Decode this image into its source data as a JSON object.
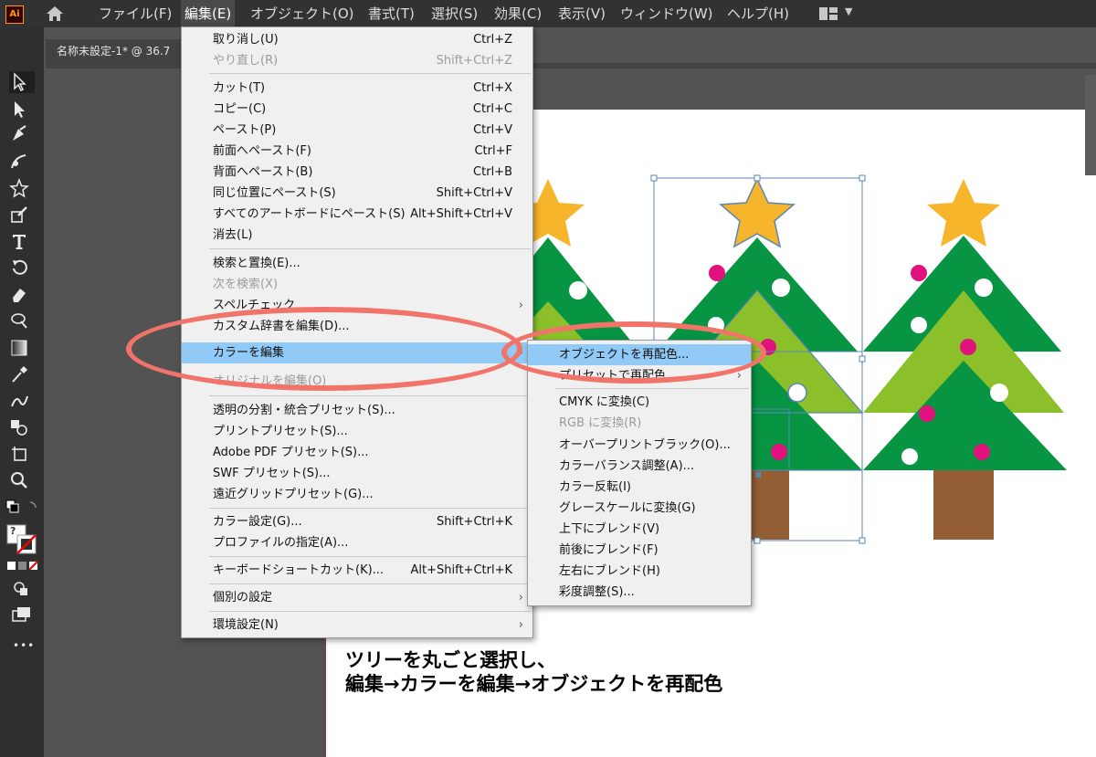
{
  "app": {
    "logo_text": "Ai"
  },
  "menubar": {
    "items": [
      "ファイル(F)",
      "編集(E)",
      "オブジェクト(O)",
      "書式(T)",
      "選択(S)",
      "効果(C)",
      "表示(V)",
      "ウィンドウ(W)",
      "ヘルプ(H)"
    ]
  },
  "document": {
    "tab_title": "名称未設定-1* @ 36.7"
  },
  "edit_menu": {
    "items": [
      {
        "label": "取り消し(U)",
        "shortcut": "Ctrl+Z"
      },
      {
        "label": "やり直し(R)",
        "shortcut": "Shift+Ctrl+Z",
        "disabled": true
      },
      {
        "label": "カット(T)",
        "shortcut": "Ctrl+X"
      },
      {
        "label": "コピー(C)",
        "shortcut": "Ctrl+C"
      },
      {
        "label": "ペースト(P)",
        "shortcut": "Ctrl+V"
      },
      {
        "label": "前面へペースト(F)",
        "shortcut": "Ctrl+F"
      },
      {
        "label": "背面へペースト(B)",
        "shortcut": "Ctrl+B"
      },
      {
        "label": "同じ位置にペースト(S)",
        "shortcut": "Shift+Ctrl+V"
      },
      {
        "label": "すべてのアートボードにペースト(S)",
        "shortcut": "Alt+Shift+Ctrl+V"
      },
      {
        "label": "消去(L)",
        "shortcut": ""
      },
      {
        "label": "検索と置換(E)...",
        "shortcut": ""
      },
      {
        "label": "次を検索(X)",
        "shortcut": "",
        "disabled": true
      },
      {
        "label": "スペルチェック",
        "shortcut": "",
        "submenu": true
      },
      {
        "label": "カスタム辞書を編集(D)...",
        "shortcut": ""
      },
      {
        "label": "カラーを編集",
        "shortcut": "",
        "submenu": true,
        "highlighted": true
      },
      {
        "label": "オリジナルを編集(O)",
        "shortcut": "",
        "disabled": true
      },
      {
        "label": "透明の分割・統合プリセット(S)...",
        "shortcut": ""
      },
      {
        "label": "プリントプリセット(S)...",
        "shortcut": ""
      },
      {
        "label": "Adobe PDF プリセット(S)...",
        "shortcut": ""
      },
      {
        "label": "SWF プリセット(S)...",
        "shortcut": ""
      },
      {
        "label": "遠近グリッドプリセット(G)...",
        "shortcut": ""
      },
      {
        "label": "カラー設定(G)...",
        "shortcut": "Shift+Ctrl+K"
      },
      {
        "label": "プロファイルの指定(A)...",
        "shortcut": ""
      },
      {
        "label": "キーボードショートカット(K)...",
        "shortcut": "Alt+Shift+Ctrl+K"
      },
      {
        "label": "個別の設定",
        "shortcut": "",
        "submenu": true
      },
      {
        "label": "環境設定(N)",
        "shortcut": "",
        "submenu": true
      }
    ],
    "submenu_arrow": "›"
  },
  "color_submenu": {
    "items": [
      {
        "label": "オブジェクトを再配色...",
        "highlighted": true
      },
      {
        "label": "プリセットで再配色",
        "submenu": true
      },
      {
        "label": "CMYK に変換(C)"
      },
      {
        "label": "RGB に変換(R)",
        "disabled": true
      },
      {
        "label": "オーバープリントブラック(O)..."
      },
      {
        "label": "カラーバランス調整(A)..."
      },
      {
        "label": "カラー反転(I)"
      },
      {
        "label": "グレースケールに変換(G)"
      },
      {
        "label": "上下にブレンド(V)"
      },
      {
        "label": "前後にブレンド(F)"
      },
      {
        "label": "左右にブレンド(H)"
      },
      {
        "label": "彩度調整(S)..."
      }
    ]
  },
  "caption": {
    "line1": "ツリーを丸ごと選択し、",
    "line2": "編集→カラーを編集→オブジェクトを再配色"
  },
  "toolbar": {
    "more_label": "•••",
    "fill_label": "?"
  },
  "colors": {
    "tree_dark": "#079443",
    "tree_light": "#8cc02a",
    "star": "#f7b52c",
    "ornament": "#e0137e",
    "trunk": "#935e33",
    "highlight": "#91c9f7",
    "oval": "#f0746a"
  }
}
